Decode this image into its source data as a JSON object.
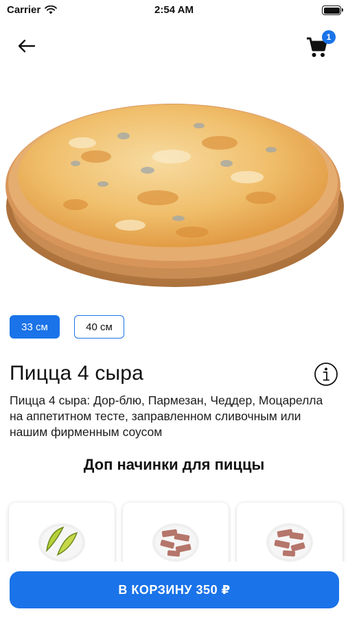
{
  "status_bar": {
    "carrier": "Carrier",
    "time": "2:54 AM"
  },
  "nav": {
    "cart_count": "1"
  },
  "product": {
    "sizes": [
      {
        "label": "33 см",
        "selected": true
      },
      {
        "label": "40 см",
        "selected": false
      }
    ],
    "title": "Пицца 4 сыра",
    "description": "Пицца 4 сыра: Дор-блю, Пармезан, Чеддер, Моцарелла на аппетитном тесте, заправленном сливочным или нашим фирменным соусом"
  },
  "toppings": {
    "title": "Доп начинки для пиццы",
    "items": [
      {
        "icon": "lime-slices"
      },
      {
        "icon": "meat-pieces"
      },
      {
        "icon": "meat-pieces"
      }
    ]
  },
  "cta": {
    "label": "В КОРЗИНУ 350 ₽"
  },
  "colors": {
    "accent": "#1a73e8"
  }
}
